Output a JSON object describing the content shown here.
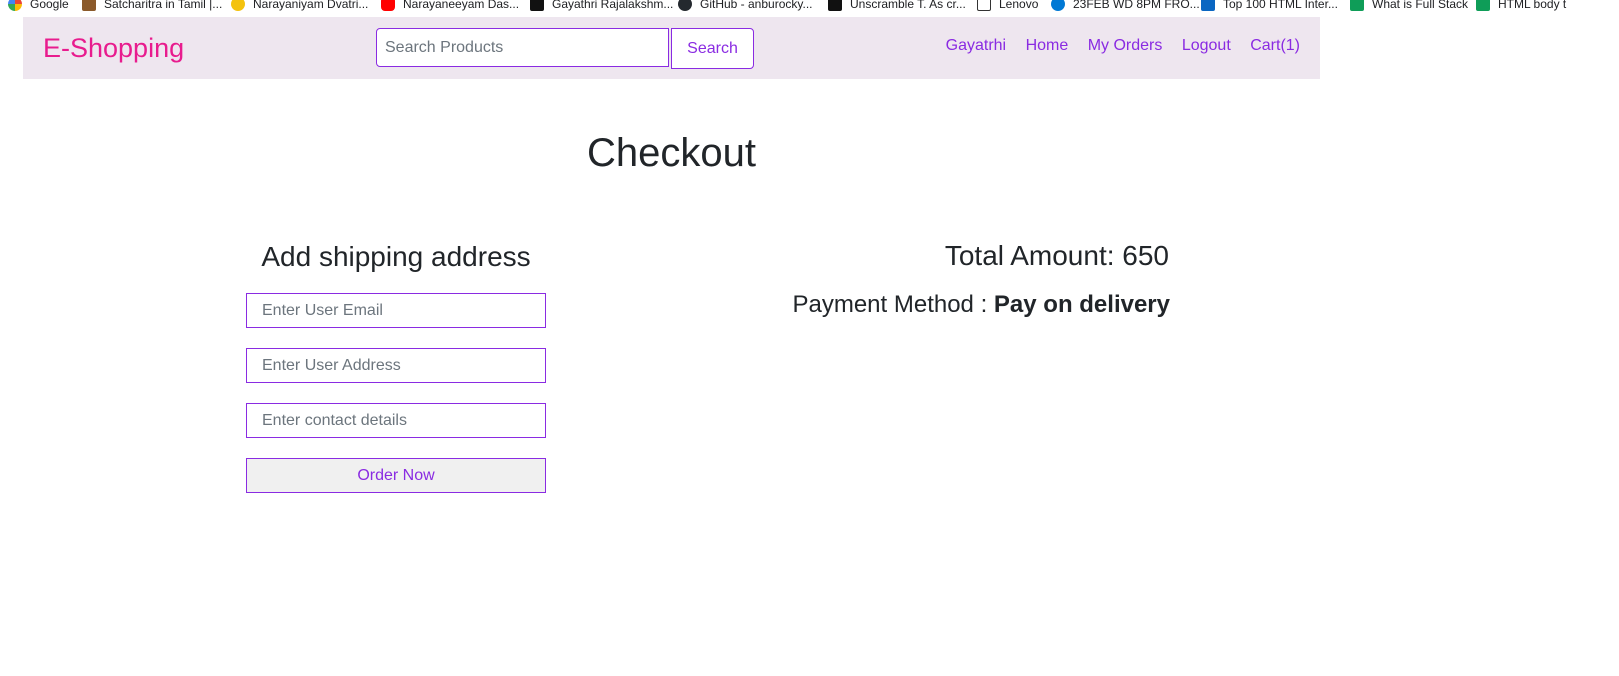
{
  "bookmarks": [
    {
      "label": "Google",
      "icon": "google-icon",
      "color": "#4285f4"
    },
    {
      "label": "Satcharitra in Tamil |...",
      "icon": "image-icon",
      "color": "#8b5a2b"
    },
    {
      "label": "Narayaniyam Dvatri...",
      "icon": "info-circle-icon",
      "color": "#f4c20d"
    },
    {
      "label": "Narayaneeyam Das...",
      "icon": "youtube-icon",
      "color": "#ff0000"
    },
    {
      "label": "Gayathri Rajalakshm...",
      "icon": "app-icon",
      "color": "#111111"
    },
    {
      "label": "GitHub - anburocky...",
      "icon": "github-icon",
      "color": "#24292e"
    },
    {
      "label": "Unscramble T. As cr...",
      "icon": "bookmark-icon",
      "color": "#111111"
    },
    {
      "label": "Lenovo",
      "icon": "page-icon",
      "color": "#ffffff"
    },
    {
      "label": "23FEB WD 8PM FRO...",
      "icon": "cloud-icon",
      "color": "#0078d4"
    },
    {
      "label": "Top 100 HTML Inter...",
      "icon": "linkedin-icon",
      "color": "#0a66c2"
    },
    {
      "label": "What is Full Stack",
      "icon": "w-icon",
      "color": "#0f9d58"
    },
    {
      "label": "HTML body t",
      "icon": "w-icon",
      "color": "#0f9d58"
    }
  ],
  "navbar": {
    "brand": "E-Shopping",
    "search_placeholder": "Search Products",
    "search_button": "Search",
    "links": [
      "Gayatrhi",
      "Home",
      "My Orders",
      "Logout",
      "Cart(1)"
    ]
  },
  "main": {
    "title": "Checkout",
    "shipping_heading": "Add shipping address",
    "email_placeholder": "Enter User Email",
    "address_placeholder": "Enter User Address",
    "contact_placeholder": "Enter contact details",
    "order_button": "Order Now",
    "total_label": "Total Amount: 650",
    "payment_label": "Payment Method : ",
    "payment_value": "Pay on delivery"
  },
  "colors": {
    "brand": "#e81c8e",
    "accent": "#8a2be2",
    "navbar_bg": "#eee6ef"
  }
}
